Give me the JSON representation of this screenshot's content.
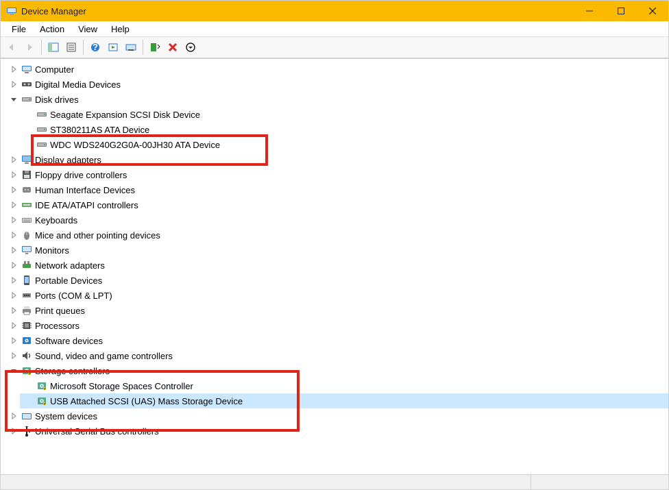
{
  "window": {
    "title": "Device Manager"
  },
  "menu": {
    "file": "File",
    "action": "Action",
    "view": "View",
    "help": "Help"
  },
  "tree": [
    {
      "label": "Computer",
      "icon": "computer",
      "expanded": false,
      "children": []
    },
    {
      "label": "Digital Media Devices",
      "icon": "media",
      "expanded": false,
      "children": []
    },
    {
      "label": "Disk drives",
      "icon": "disk",
      "expanded": true,
      "children": [
        {
          "label": "Seagate Expansion SCSI Disk Device",
          "icon": "disk"
        },
        {
          "label": "ST380211AS ATA Device",
          "icon": "disk"
        },
        {
          "label": "WDC WDS240G2G0A-00JH30 ATA Device",
          "icon": "disk"
        }
      ]
    },
    {
      "label": "Display adapters",
      "icon": "display",
      "expanded": false,
      "children": []
    },
    {
      "label": "Floppy drive controllers",
      "icon": "floppy",
      "expanded": false,
      "children": []
    },
    {
      "label": "Human Interface Devices",
      "icon": "hid",
      "expanded": false,
      "children": []
    },
    {
      "label": "IDE ATA/ATAPI controllers",
      "icon": "ide",
      "expanded": false,
      "children": []
    },
    {
      "label": "Keyboards",
      "icon": "keyboard",
      "expanded": false,
      "children": []
    },
    {
      "label": "Mice and other pointing devices",
      "icon": "mouse",
      "expanded": false,
      "children": []
    },
    {
      "label": "Monitors",
      "icon": "monitor",
      "expanded": false,
      "children": []
    },
    {
      "label": "Network adapters",
      "icon": "network",
      "expanded": false,
      "children": []
    },
    {
      "label": "Portable Devices",
      "icon": "portable",
      "expanded": false,
      "children": []
    },
    {
      "label": "Ports (COM & LPT)",
      "icon": "port",
      "expanded": false,
      "children": []
    },
    {
      "label": "Print queues",
      "icon": "printer",
      "expanded": false,
      "children": []
    },
    {
      "label": "Processors",
      "icon": "cpu",
      "expanded": false,
      "children": []
    },
    {
      "label": "Software devices",
      "icon": "software",
      "expanded": false,
      "children": []
    },
    {
      "label": "Sound, video and game controllers",
      "icon": "sound",
      "expanded": false,
      "children": []
    },
    {
      "label": "Storage controllers",
      "icon": "storage",
      "expanded": true,
      "children": [
        {
          "label": "Microsoft Storage Spaces Controller",
          "icon": "storage"
        },
        {
          "label": "USB Attached SCSI (UAS) Mass Storage Device",
          "icon": "storage",
          "selected": true
        }
      ]
    },
    {
      "label": "System devices",
      "icon": "system",
      "expanded": false,
      "children": []
    },
    {
      "label": "Universal Serial Bus controllers",
      "icon": "usb",
      "expanded": false,
      "children": []
    }
  ]
}
